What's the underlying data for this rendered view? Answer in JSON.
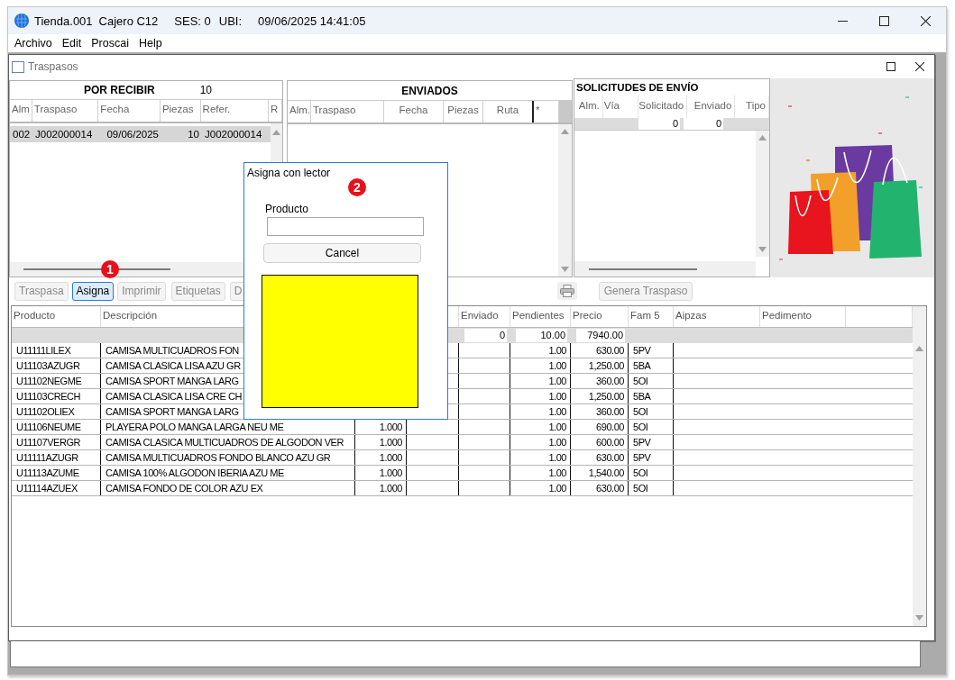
{
  "window": {
    "title": [
      "Tienda.001",
      "Cajero C12",
      "SES: 0",
      "UBI:",
      "09/06/2025 14:41:05"
    ]
  },
  "menu": [
    "Archivo",
    "Edit",
    "Proscai",
    "Help"
  ],
  "child_window": {
    "title": "Traspasos"
  },
  "por_recibir": {
    "title": "POR RECIBIR",
    "count": "10",
    "columns": [
      "Alm",
      "Traspaso",
      "Fecha",
      "Piezas",
      "Refer.",
      "R"
    ],
    "rows": [
      {
        "cells": [
          "002",
          "J002000014",
          "09/06/2025",
          "10",
          "J002000014"
        ],
        "selected": true
      }
    ]
  },
  "enviados": {
    "title": "ENVIADOS",
    "columns": [
      "Alm.",
      "Traspaso",
      "Fecha",
      "Piezas",
      "Ruta",
      "*"
    ]
  },
  "solicitudes": {
    "title": "SOLICITUDES DE ENVÍO",
    "columns": [
      "Alm.",
      "Vía",
      "Solicitado",
      "Enviado",
      "Tipo"
    ],
    "solicitado_total": "0",
    "enviado_total": "0"
  },
  "banner": {
    "kind": "picture"
  },
  "toolbar": {
    "buttons": [
      {
        "label": "Traspasa",
        "selected": false,
        "disabled": true
      },
      {
        "label": "Asigna",
        "selected": true,
        "disabled": false
      },
      {
        "label": "Imprimir",
        "selected": false,
        "disabled": true
      },
      {
        "label": "Etiquetas",
        "selected": false,
        "disabled": true
      },
      {
        "label": "D",
        "selected": false,
        "disabled": true
      }
    ],
    "generate_button": {
      "label": "Genera Traspaso",
      "disabled": true
    }
  },
  "grid": {
    "columns": [
      {
        "label": "Producto"
      },
      {
        "label": "Descripción"
      },
      {},
      {},
      {
        "label": "Enviado"
      },
      {
        "label": "Pendientes"
      },
      {
        "label": "Precio"
      },
      {
        "label": "Fam 5"
      },
      {
        "label": "Aipzas"
      },
      {
        "label": "Pedimento"
      }
    ],
    "totals": {
      "enviado": "0",
      "pendientes": "10.00",
      "precio": "7940.00"
    },
    "rows": [
      {
        "producto": "U11111LILEX",
        "descripcion": "CAMISA MULTICUADROS FON",
        "pendientes": "1.00",
        "precio": "630.00",
        "fam5": "5PV"
      },
      {
        "producto": "U11103AZUGR",
        "descripcion": "CAMISA CLASICA LISA AZU GR",
        "pendientes": "1.00",
        "precio": "1,250.00",
        "fam5": "5BA"
      },
      {
        "producto": "U11102NEGME",
        "descripcion": "CAMISA SPORT MANGA LARG",
        "pendientes": "1.00",
        "precio": "360.00",
        "fam5": "5OI"
      },
      {
        "producto": "U11103CRECH",
        "descripcion": "CAMISA CLASICA LISA CRE CH",
        "pendientes": "1.00",
        "precio": "1,250.00",
        "fam5": "5BA"
      },
      {
        "producto": "U11102OLIEX",
        "descripcion": "CAMISA SPORT MANGA LARG",
        "pendientes": "1.00",
        "precio": "360.00",
        "fam5": "5OI"
      },
      {
        "producto": "U11106NEUME",
        "descripcion": "PLAYERA POLO MANGA LARGA NEU ME",
        "cantidad": "1.000",
        "pendientes": "1.00",
        "precio": "690.00",
        "fam5": "5OI"
      },
      {
        "producto": "U11107VERGR",
        "descripcion": "CAMISA CLASICA MULTICUADROS DE ALGODON VER",
        "cantidad": "1.000",
        "pendientes": "1.00",
        "precio": "600.00",
        "fam5": "5PV"
      },
      {
        "producto": "U11111AZUGR",
        "descripcion": "CAMISA MULTICUADROS FONDO BLANCO AZU GR",
        "cantidad": "1.000",
        "pendientes": "1.00",
        "precio": "630.00",
        "fam5": "5PV"
      },
      {
        "producto": "U11113AZUME",
        "descripcion": "CAMISA 100% ALGODON IBERIA AZU ME",
        "cantidad": "1.000",
        "pendientes": "1.00",
        "precio": "1,540.00",
        "fam5": "5OI"
      },
      {
        "producto": "U11114AZUEX",
        "descripcion": "CAMISA FONDO DE COLOR AZU EX",
        "cantidad": "1.000",
        "pendientes": "1.00",
        "precio": "630.00",
        "fam5": "5OI"
      }
    ]
  },
  "dialog": {
    "title": "Asigna con lector",
    "field_label": "Producto",
    "cancel_button": "Cancel"
  },
  "markers": [
    "1",
    "2"
  ]
}
